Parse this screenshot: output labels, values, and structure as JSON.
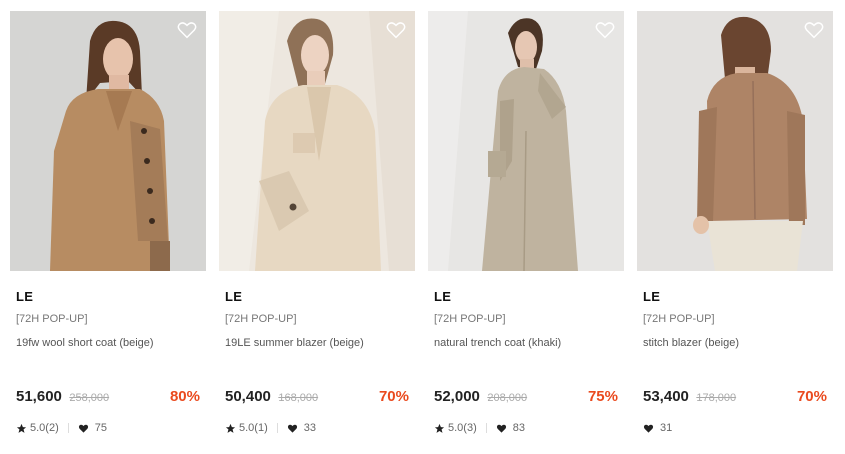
{
  "products": [
    {
      "brand": "LE",
      "tag": "[72H POP-UP]",
      "name": "19fw wool short coat (beige)",
      "price": "51,600",
      "original_price": "258,000",
      "discount": "80%",
      "rating": "5.0(2)",
      "likes": "75",
      "bg_color": "#d9d9d7",
      "coat_color": "#b78c62"
    },
    {
      "brand": "LE",
      "tag": "[72H POP-UP]",
      "name": "19LE summer blazer (beige)",
      "price": "50,400",
      "original_price": "168,000",
      "discount": "70%",
      "rating": "5.0(1)",
      "likes": "33",
      "bg_color": "#ece6de",
      "coat_color": "#e6d6bf"
    },
    {
      "brand": "LE",
      "tag": "[72H POP-UP]",
      "name": "natural trench coat (khaki)",
      "price": "52,000",
      "original_price": "208,000",
      "discount": "75%",
      "rating": "5.0(3)",
      "likes": "83",
      "bg_color": "#e7e6e4",
      "coat_color": "#bfb39f"
    },
    {
      "brand": "LE",
      "tag": "[72H POP-UP]",
      "name": "stitch blazer (beige)",
      "price": "53,400",
      "original_price": "178,000",
      "discount": "70%",
      "rating": "",
      "likes": "31",
      "bg_color": "#e3e1df",
      "coat_color": "#ae8466"
    }
  ],
  "colors": {
    "discount": "#ea4a1e",
    "icons": "#222222"
  },
  "icons": {
    "wishlist": "heart-outline-icon",
    "rating": "star-icon",
    "likes": "heart-icon"
  }
}
